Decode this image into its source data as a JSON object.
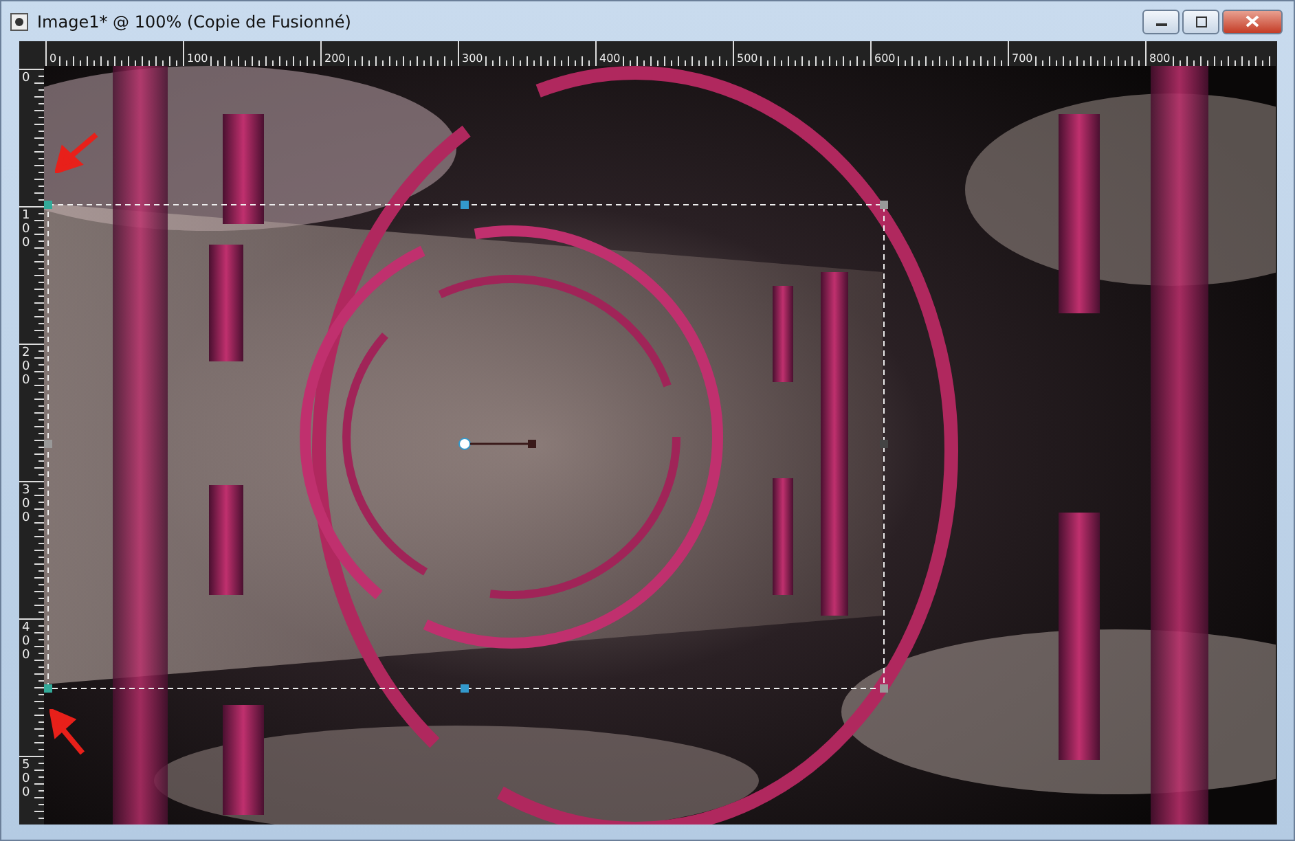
{
  "window": {
    "title": "Image1* @ 100% (Copie de Fusionné)"
  },
  "rulers": {
    "horizontal_labels": [
      "0",
      "100",
      "200",
      "300",
      "400",
      "500",
      "600",
      "700",
      "800"
    ],
    "vertical_labels": [
      "0",
      "100",
      "200",
      "300",
      "400",
      "500"
    ]
  }
}
